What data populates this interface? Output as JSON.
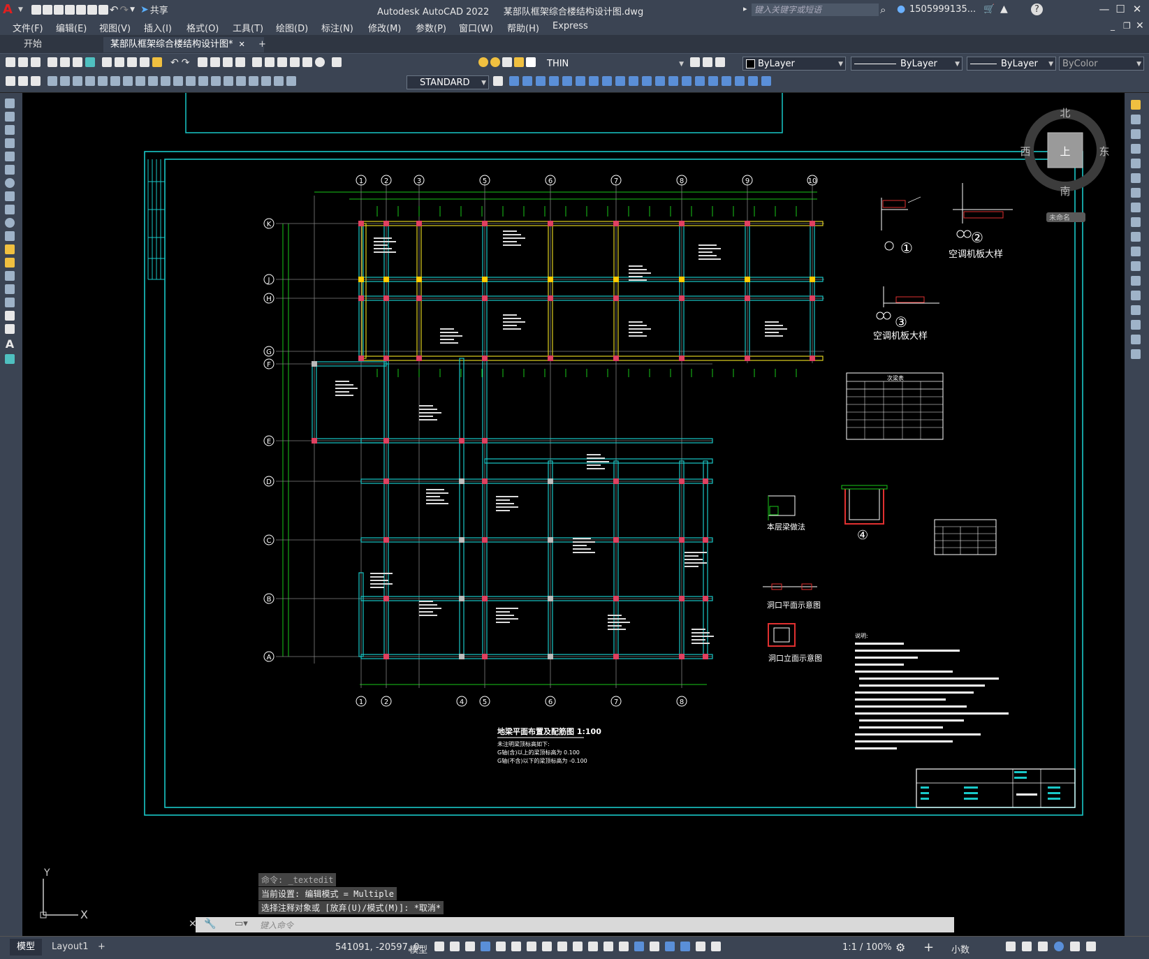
{
  "app": {
    "title": "Autodesk AutoCAD 2022",
    "file": "某部队框架综合楼结构设计图.dwg",
    "search_placeholder": "键入关键字或短语",
    "user": "1505999135...",
    "share": "共享"
  },
  "menu": [
    "文件(F)",
    "编辑(E)",
    "视图(V)",
    "插入(I)",
    "格式(O)",
    "工具(T)",
    "绘图(D)",
    "标注(N)",
    "修改(M)",
    "参数(P)",
    "窗口(W)",
    "帮助(H)",
    "Express"
  ],
  "tabs": {
    "start": "开始",
    "doc": "某部队框架综合楼结构设计图*",
    "add": "+"
  },
  "toolbar": {
    "layer": "THIN",
    "color": "ByLayer",
    "linetype": "ByLayer",
    "lineweight": "ByLayer",
    "plotstyle": "ByColor",
    "textstyle": "STANDARD"
  },
  "viewcube": {
    "north": "北",
    "south": "南",
    "east": "东",
    "west": "西",
    "top": "上",
    "wcs": "未命名"
  },
  "drawing": {
    "axes_top": [
      "1",
      "2",
      "3",
      "5",
      "6",
      "7",
      "8",
      "9",
      "10"
    ],
    "axes_bottom": [
      "1",
      "2",
      "4",
      "5",
      "6",
      "7",
      "8"
    ],
    "axes_left": [
      "K",
      "J",
      "H",
      "G",
      "F",
      "E",
      "D",
      "C",
      "B",
      "A"
    ],
    "plan_title": "地梁平面布置及配筋图  1:100",
    "plan_note1": "未注明梁顶标高如下:",
    "plan_note2": "G轴(含)以上的梁顶标高为 0.100",
    "plan_note3": "G轴(不含)以下的梁顶标高为 -0.100",
    "detail1": "①",
    "detail2": "②",
    "detail3": "③",
    "detail4": "④",
    "ac_label1": "空调机板大样",
    "ac_label2": "空调机板大样",
    "beam_method": "本层梁做法",
    "hole_plan": "洞口平面示意图",
    "hole_elev": "洞口立面示意图",
    "table_title": "次梁表",
    "notes_title": "说明:"
  },
  "command": {
    "line1": "命令: _textedit",
    "line2": "当前设置: 编辑模式 = Multiple",
    "line3": "选择注释对象或 [放弃(U)/模式(M)]: *取消*",
    "placeholder": "键入命令"
  },
  "status": {
    "model_tab": "模型",
    "layout_tab": "Layout1",
    "coords": "541091, -20597, 0",
    "space": "模型",
    "scale": "1:1 / 100%",
    "units": "小数"
  },
  "ucs": {
    "y": "Y",
    "x": "X"
  }
}
